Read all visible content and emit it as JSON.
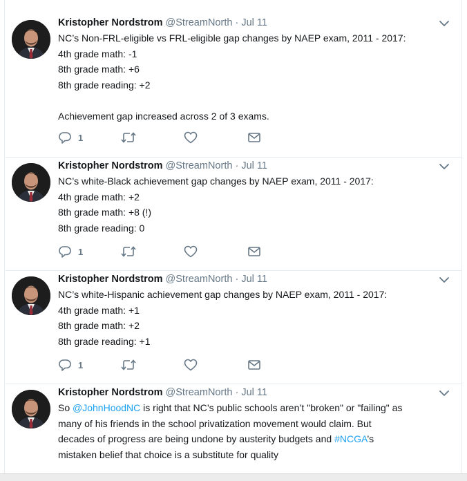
{
  "tweets": [
    {
      "author": "Kristopher Nordstrom",
      "handle": "@StreamNorth",
      "separator": "·",
      "date": "Jul 11",
      "lines": [
        "NC’s Non-FRL-eligible vs FRL-eligible gap changes by NAEP exam, 2011 - 2017:",
        "4th grade math: -1",
        "8th grade math: +6",
        "8th grade reading: +2",
        "",
        "Achievement gap increased across 2 of 3 exams."
      ],
      "reply_count": "1"
    },
    {
      "author": "Kristopher Nordstrom",
      "handle": "@StreamNorth",
      "separator": "·",
      "date": "Jul 11",
      "lines": [
        "NC’s white-Black achievement gap changes by NAEP exam, 2011 - 2017:",
        "4th grade math: +2",
        "8th grade math: +8 (!)",
        "8th grade reading: 0"
      ],
      "reply_count": "1"
    },
    {
      "author": "Kristopher Nordstrom",
      "handle": "@StreamNorth",
      "separator": "·",
      "date": "Jul 11",
      "lines": [
        "NC’s white-Hispanic achievement gap changes by NAEP exam, 2011 - 2017:",
        "4th grade math: +1",
        "8th grade math: +2",
        "8th grade reading: +1"
      ],
      "reply_count": "1"
    },
    {
      "author": "Kristopher Nordstrom",
      "handle": "@StreamNorth",
      "separator": "·",
      "date": "Jul 11",
      "text_parts": {
        "p1": "So ",
        "mention": "@JohnHoodNC",
        "p2": " is right that NC’s public schools aren’t \"broken\" or \"failing\" as",
        "p3": "many of his friends in the school privatization movement would claim. But",
        "p4": "decades of progress are being undone by austerity budgets and ",
        "hashtag": "#NCGA",
        "p5": "’s",
        "p6": "mistaken belief that choice is a substitute for quality"
      }
    }
  ],
  "colors": {
    "link": "#1da1f2",
    "secondary_text": "#657786",
    "divider": "#e6ecf0"
  },
  "icons": {
    "reply": "reply-icon",
    "retweet": "retweet-icon",
    "like": "heart-icon",
    "dm": "envelope-icon",
    "caret": "chevron-down-icon"
  }
}
